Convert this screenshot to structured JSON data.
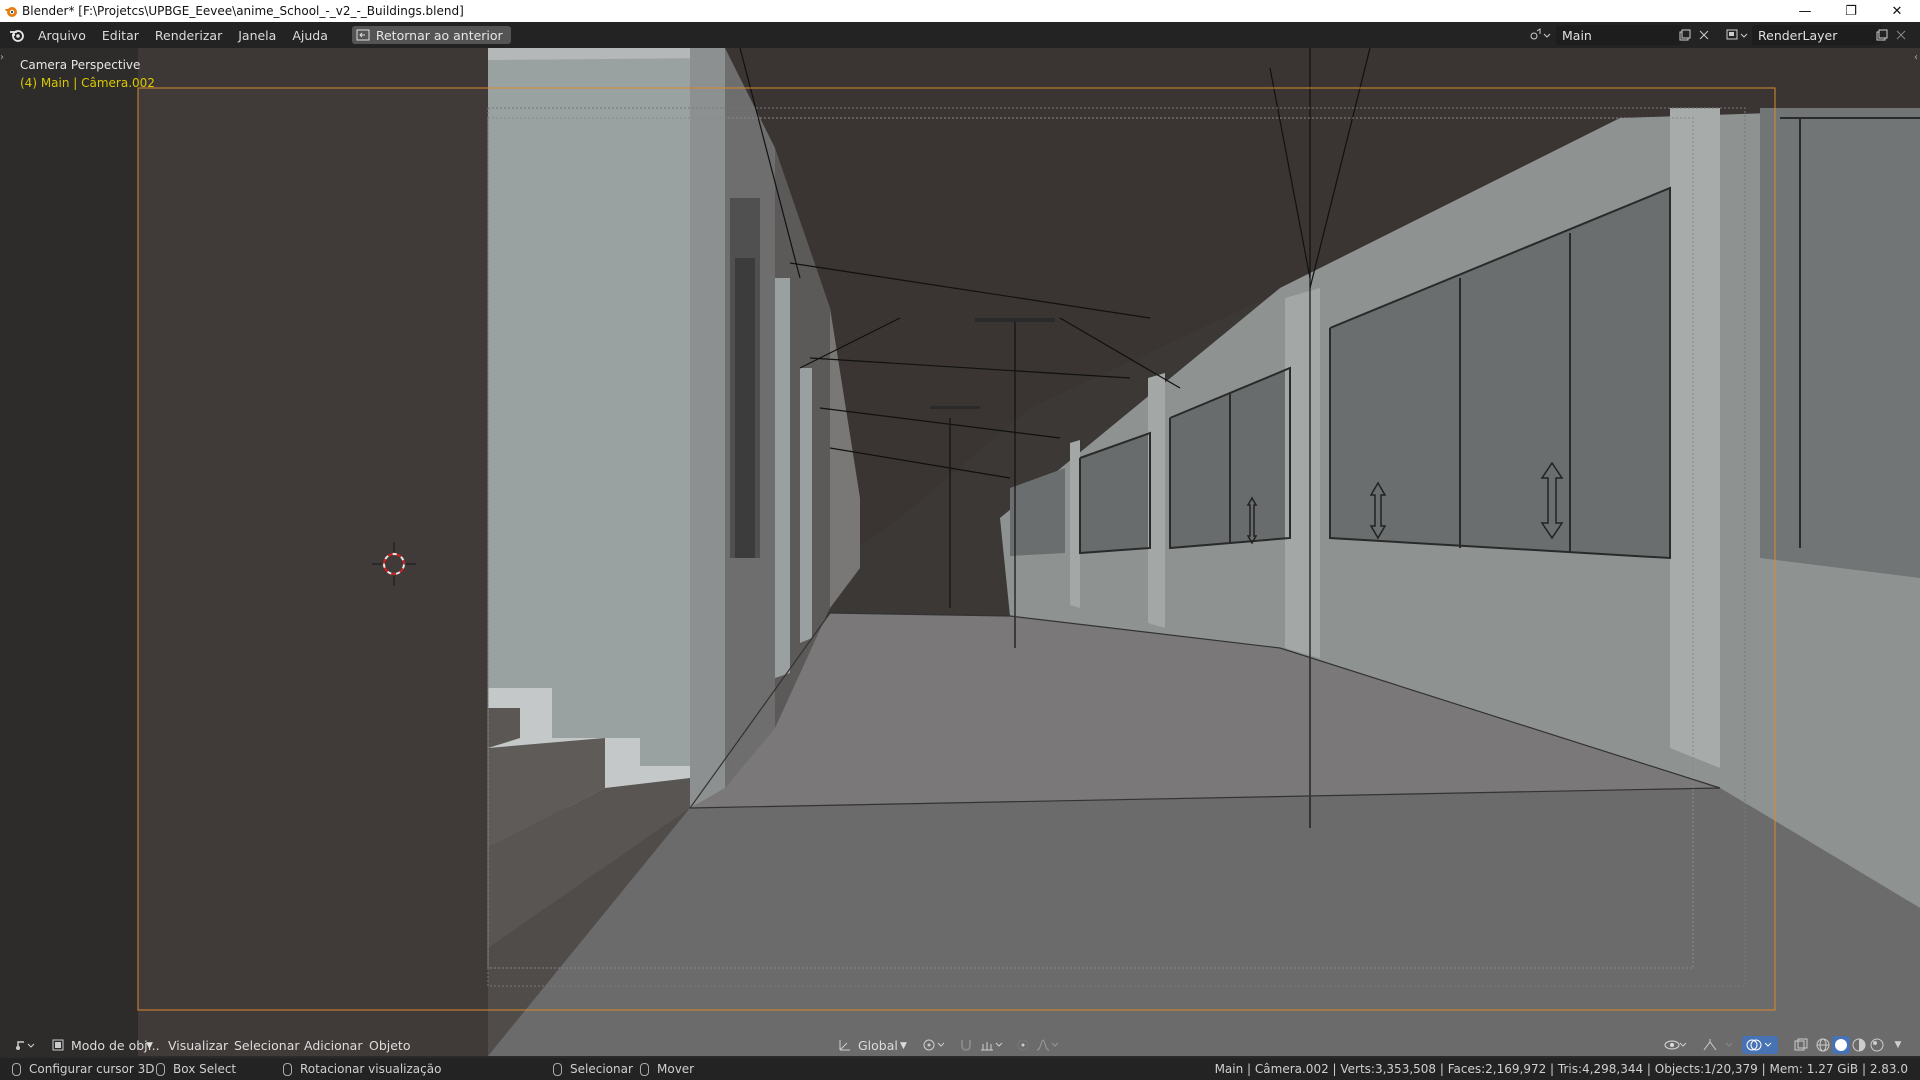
{
  "window": {
    "title": "Blender* [F:\\Projetcs\\UPBGE_Eevee\\anime_School_-_v2_-_Buildings.blend]",
    "controls": [
      "—",
      "❐",
      "✕"
    ]
  },
  "topbar": {
    "menus": [
      "Arquivo",
      "Editar",
      "Renderizar",
      "Janela",
      "Ajuda"
    ],
    "return_button": "Retornar ao anterior",
    "scene_name": "Main",
    "layer_name": "RenderLayer"
  },
  "viewport": {
    "view_name": "Camera Perspective",
    "view_info": "(4) Main | Câmera.002"
  },
  "view_header": {
    "mode": "Modo de obj...",
    "menus": [
      "Visualizar",
      "Selecionar",
      "Adicionar",
      "Objeto"
    ],
    "orientation": "Global"
  },
  "statusbar": {
    "hints": [
      "Configurar cursor 3D",
      "Box Select",
      "Rotacionar visualização",
      "Selecionar",
      "Mover"
    ],
    "stats": "Main | Câmera.002 | Verts:3,353,508 | Faces:2,169,972 | Tris:4,298,344 | Objects:1/20,379 | Mem: 1.27 GiB | 2.83.0"
  },
  "colors": {
    "accent_selected": "#e0a000",
    "camera_frame": "#d98a2b",
    "info_text": "#d9c700"
  }
}
